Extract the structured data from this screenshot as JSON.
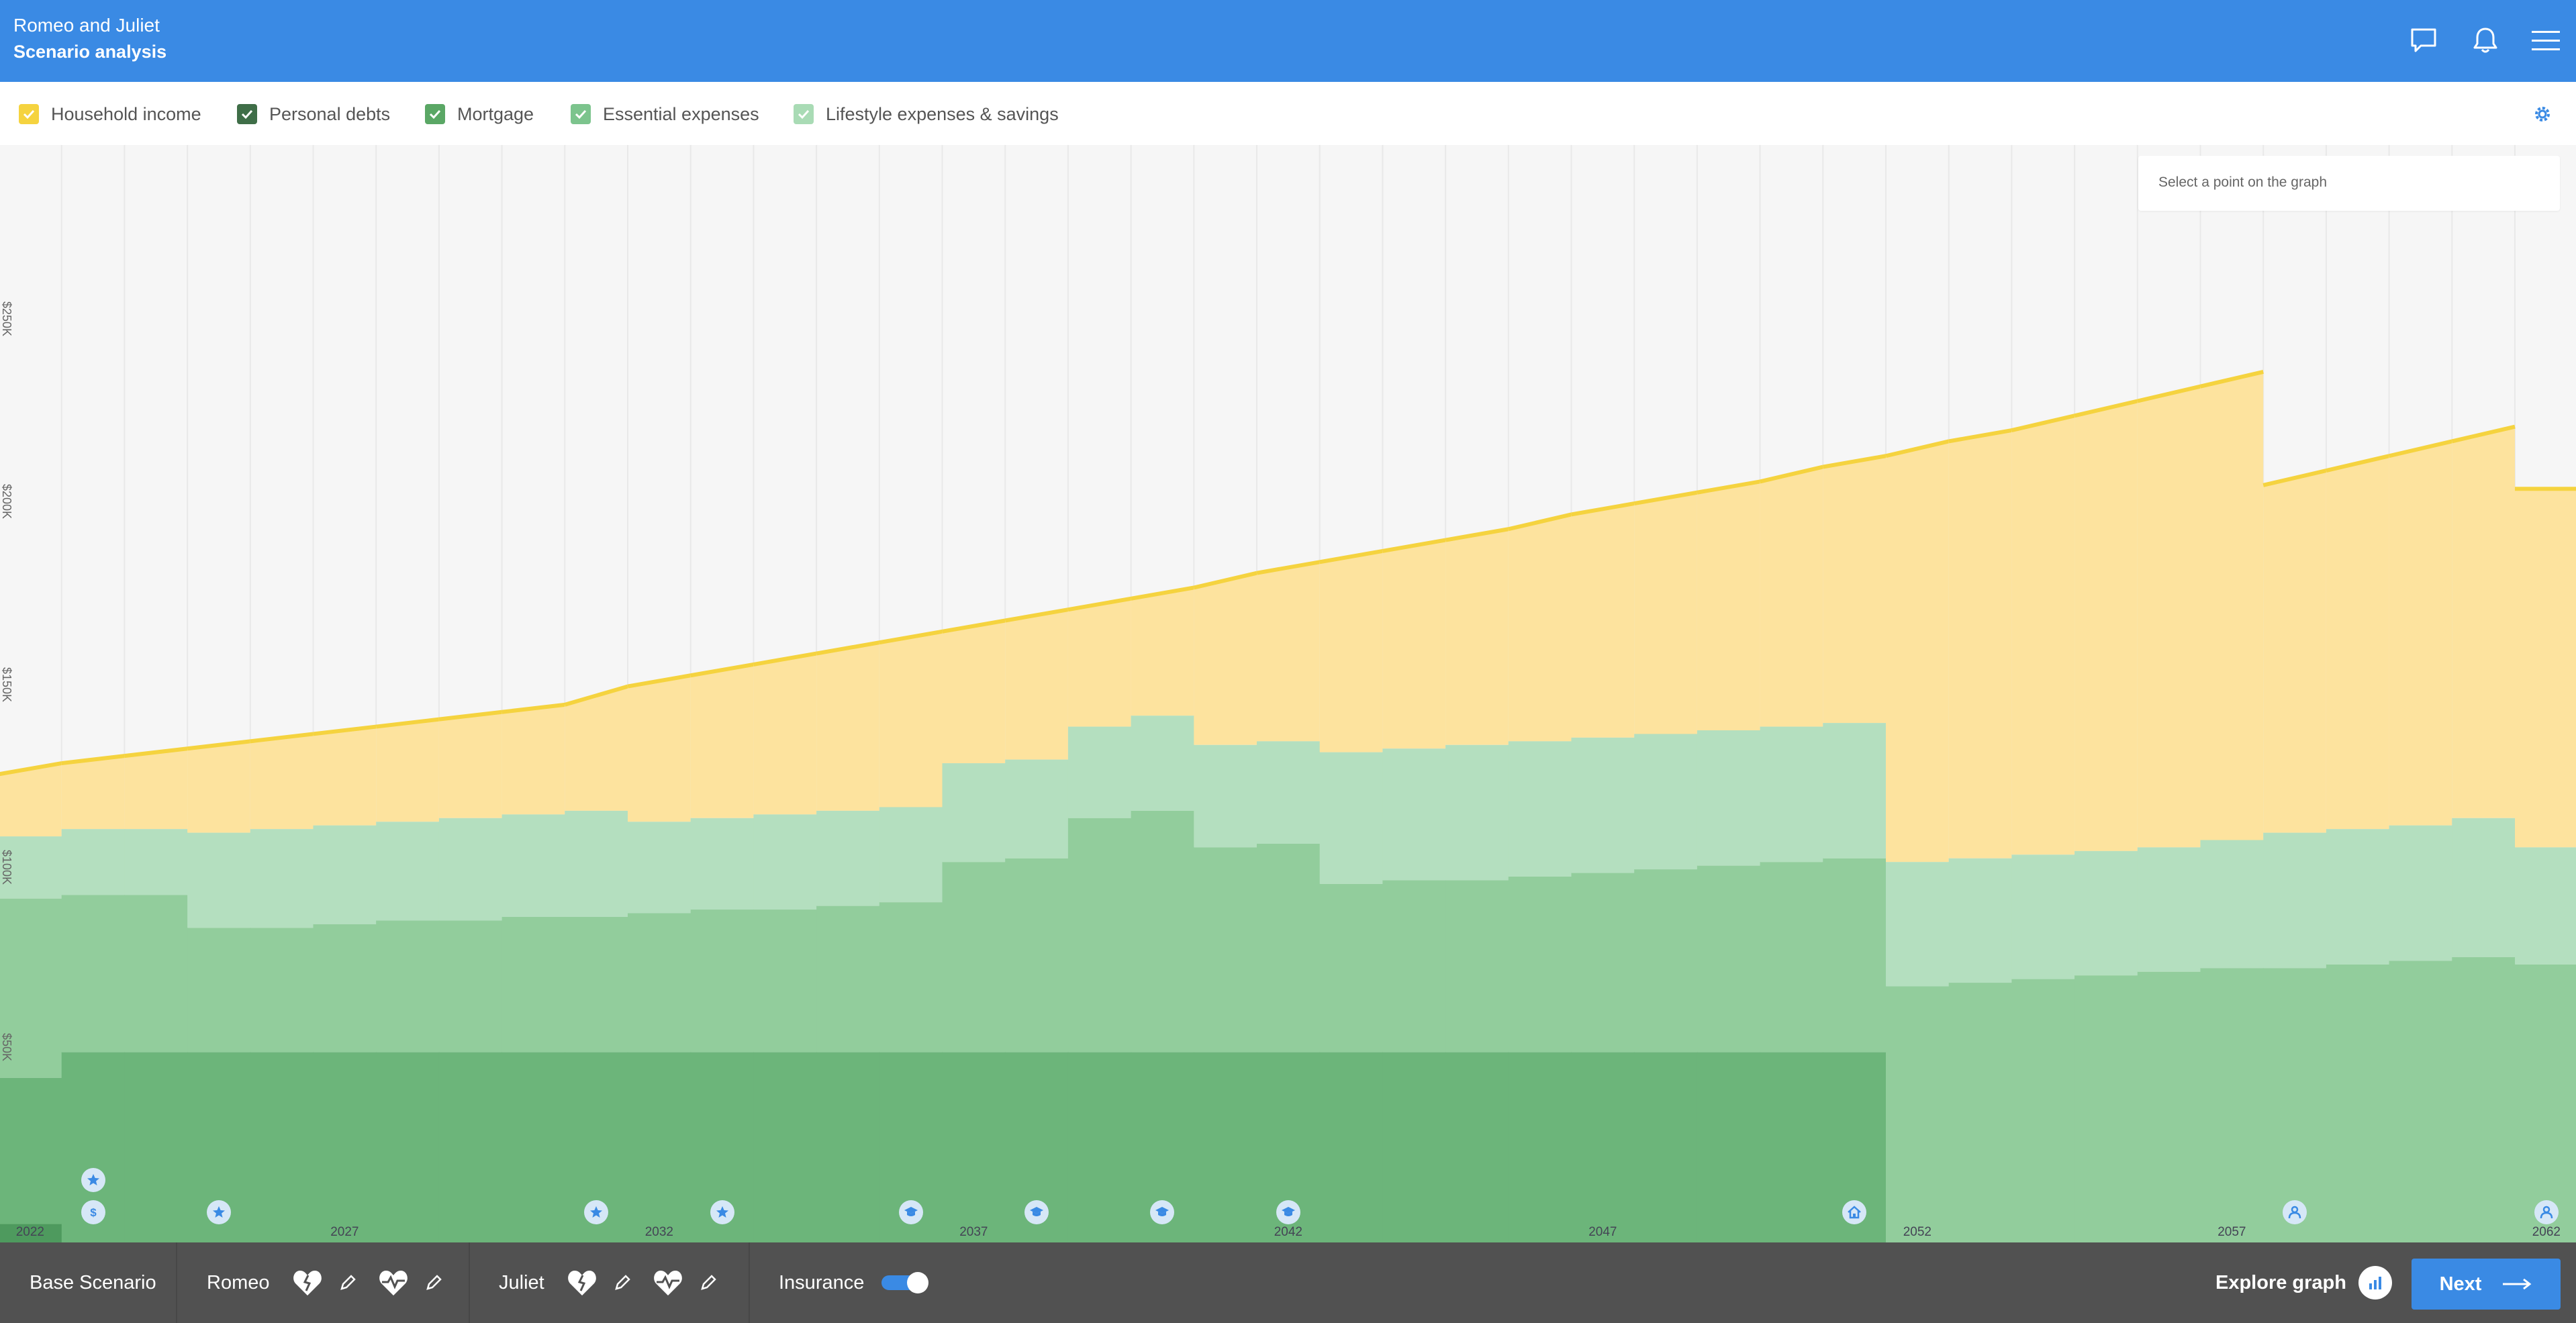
{
  "header": {
    "client_name": "Romeo and Juliet",
    "page_title": "Scenario analysis",
    "icons": [
      "chat-icon",
      "bell-icon",
      "menu-icon"
    ]
  },
  "legend": [
    {
      "label": "Household income",
      "checked": true,
      "color": "#f5d33f"
    },
    {
      "label": "Personal debts",
      "checked": true,
      "color": "#3f6e48"
    },
    {
      "label": "Mortgage",
      "checked": true,
      "color": "#5aa765"
    },
    {
      "label": "Essential expenses",
      "checked": true,
      "color": "#7cc48d"
    },
    {
      "label": "Lifestyle expenses & savings",
      "checked": true,
      "color": "#a9dbb5"
    }
  ],
  "info_box": {
    "placeholder": "Select a point on the graph"
  },
  "colors": {
    "header": "#3a8ae4",
    "income_line": "#f5d33f",
    "income_fill": "#fde39e",
    "lifestyle": "#b4dfbf",
    "essential": "#92cd9c",
    "mortgage": "#6cb57a",
    "debts": "#57a467",
    "bottom_bar": "#515151"
  },
  "chart_data": {
    "type": "area",
    "title": "",
    "ylabel": "",
    "y_tick_labels": [
      "$250K",
      "$200K",
      "$150K",
      "$100K",
      "$50K"
    ],
    "x_tick_labels": [
      "2022",
      "2027",
      "2032",
      "2037",
      "2042",
      "2047",
      "2052",
      "2057",
      "2062"
    ],
    "x": [
      2022,
      2023,
      2024,
      2025,
      2026,
      2027,
      2028,
      2029,
      2030,
      2031,
      2032,
      2033,
      2034,
      2035,
      2036,
      2037,
      2038,
      2039,
      2040,
      2041,
      2042,
      2043,
      2044,
      2045,
      2046,
      2047,
      2048,
      2049,
      2050,
      2051,
      2052,
      2053,
      2054,
      2055,
      2056,
      2057,
      2058,
      2059,
      2060,
      2061,
      2062
    ],
    "ylim": [
      0,
      300
    ],
    "series": [
      {
        "name": "Household income",
        "values": [
          128,
          131,
          133,
          135,
          137,
          139,
          141,
          143,
          145,
          147,
          152,
          155,
          158,
          161,
          164,
          167,
          170,
          173,
          176,
          179,
          183,
          186,
          189,
          192,
          195,
          199,
          202,
          205,
          208,
          212,
          215,
          219,
          222,
          226,
          230,
          234,
          207,
          211,
          215,
          219,
          206
        ]
      },
      {
        "name": "Lifestyle expenses & savings",
        "values": [
          111,
          113,
          113,
          112,
          113,
          114,
          115,
          116,
          117,
          118,
          115,
          116,
          117,
          118,
          119,
          131,
          132,
          141,
          144,
          136,
          137,
          134,
          135,
          136,
          137,
          138,
          139,
          140,
          141,
          142,
          104,
          105,
          106,
          107,
          108,
          110,
          112,
          113,
          114,
          116,
          108
        ]
      },
      {
        "name": "Essential expenses",
        "values": [
          94,
          95,
          95,
          86,
          86,
          87,
          88,
          88,
          89,
          89,
          90,
          91,
          91,
          92,
          93,
          104,
          105,
          116,
          118,
          108,
          109,
          98,
          99,
          99,
          100,
          101,
          102,
          103,
          104,
          105,
          70,
          71,
          72,
          73,
          74,
          75,
          75,
          76,
          77,
          78,
          76
        ]
      },
      {
        "name": "Mortgage",
        "values": [
          45,
          52,
          52,
          52,
          52,
          52,
          52,
          52,
          52,
          52,
          52,
          52,
          52,
          52,
          52,
          52,
          52,
          52,
          52,
          52,
          52,
          52,
          52,
          52,
          52,
          52,
          52,
          52,
          52,
          52,
          0,
          0,
          0,
          0,
          0,
          0,
          0,
          0,
          0,
          0,
          0
        ]
      },
      {
        "name": "Personal debts",
        "values": [
          5,
          0,
          0,
          0,
          0,
          0,
          0,
          0,
          0,
          0,
          0,
          0,
          0,
          0,
          0,
          0,
          0,
          0,
          0,
          0,
          0,
          0,
          0,
          0,
          0,
          0,
          0,
          0,
          0,
          0,
          0,
          0,
          0,
          0,
          0,
          0,
          0,
          0,
          0,
          0,
          0
        ]
      }
    ],
    "grid": true,
    "legend_position": "top"
  },
  "events": [
    {
      "year": 2023,
      "icon": "star-icon",
      "row": 2
    },
    {
      "year": 2023,
      "icon": "dollar-icon",
      "row": 1
    },
    {
      "year": 2025,
      "icon": "star-icon",
      "row": 1
    },
    {
      "year": 2031,
      "icon": "star-icon",
      "row": 1
    },
    {
      "year": 2033,
      "icon": "star-icon",
      "row": 1
    },
    {
      "year": 2036,
      "icon": "graduation-cap-icon",
      "row": 1
    },
    {
      "year": 2038,
      "icon": "graduation-cap-icon",
      "row": 1
    },
    {
      "year": 2040,
      "icon": "graduation-cap-icon",
      "row": 1
    },
    {
      "year": 2042,
      "icon": "graduation-cap-icon",
      "row": 1
    },
    {
      "year": 2051,
      "icon": "house-icon",
      "row": 1
    },
    {
      "year": 2058,
      "icon": "person-icon",
      "row": 1
    },
    {
      "year": 2062,
      "icon": "person-icon",
      "row": 1
    }
  ],
  "bottom_bar": {
    "scenario": "Base Scenario",
    "person1": "Romeo",
    "person2": "Juliet",
    "insurance_label": "Insurance",
    "insurance_on": true,
    "explore_label": "Explore graph",
    "next_label": "Next"
  }
}
